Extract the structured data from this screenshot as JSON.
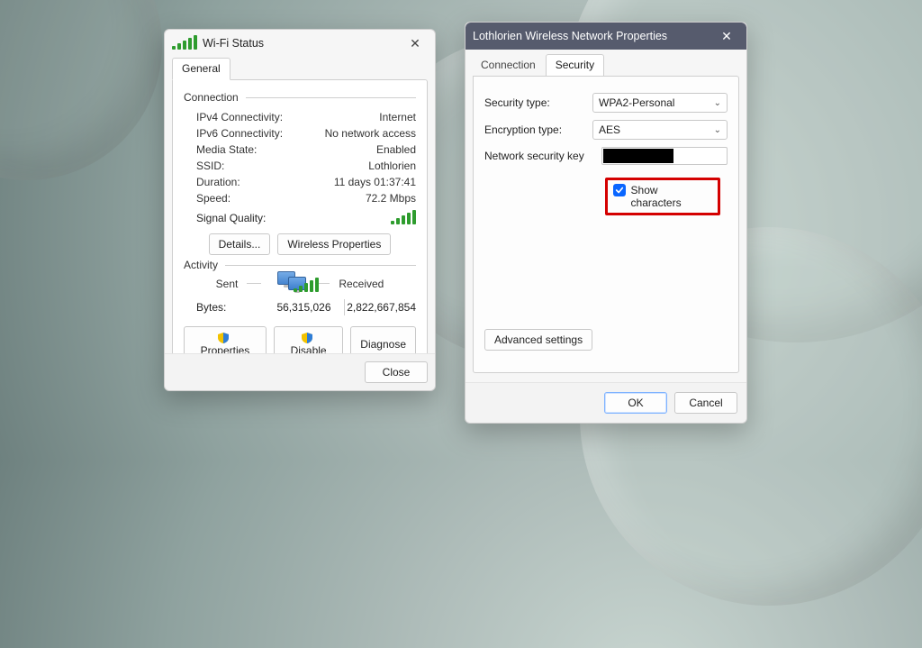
{
  "wifi": {
    "title": "Wi-Fi Status",
    "tab_general": "General",
    "group_connection": "Connection",
    "ipv4_label": "IPv4 Connectivity:",
    "ipv4_value": "Internet",
    "ipv6_label": "IPv6 Connectivity:",
    "ipv6_value": "No network access",
    "media_label": "Media State:",
    "media_value": "Enabled",
    "ssid_label": "SSID:",
    "ssid_value": "Lothlorien",
    "duration_label": "Duration:",
    "duration_value": "11 days 01:37:41",
    "speed_label": "Speed:",
    "speed_value": "72.2 Mbps",
    "sigq_label": "Signal Quality:",
    "details_btn": "Details...",
    "wprops_btn": "Wireless Properties",
    "group_activity": "Activity",
    "sent_label": "Sent",
    "received_label": "Received",
    "bytes_label": "Bytes:",
    "bytes_sent": "56,315,026",
    "bytes_recv": "2,822,667,854",
    "properties_btn": "Properties",
    "disable_btn": "Disable",
    "diagnose_btn": "Diagnose",
    "close_btn": "Close"
  },
  "props": {
    "title": "Lothlorien Wireless Network Properties",
    "tab_connection": "Connection",
    "tab_security": "Security",
    "sectype_label": "Security type:",
    "sectype_value": "WPA2-Personal",
    "enctype_label": "Encryption type:",
    "enctype_value": "AES",
    "key_label": "Network security key",
    "showchars_label": "Show characters",
    "adv_btn": "Advanced settings",
    "ok_btn": "OK",
    "cancel_btn": "Cancel"
  }
}
